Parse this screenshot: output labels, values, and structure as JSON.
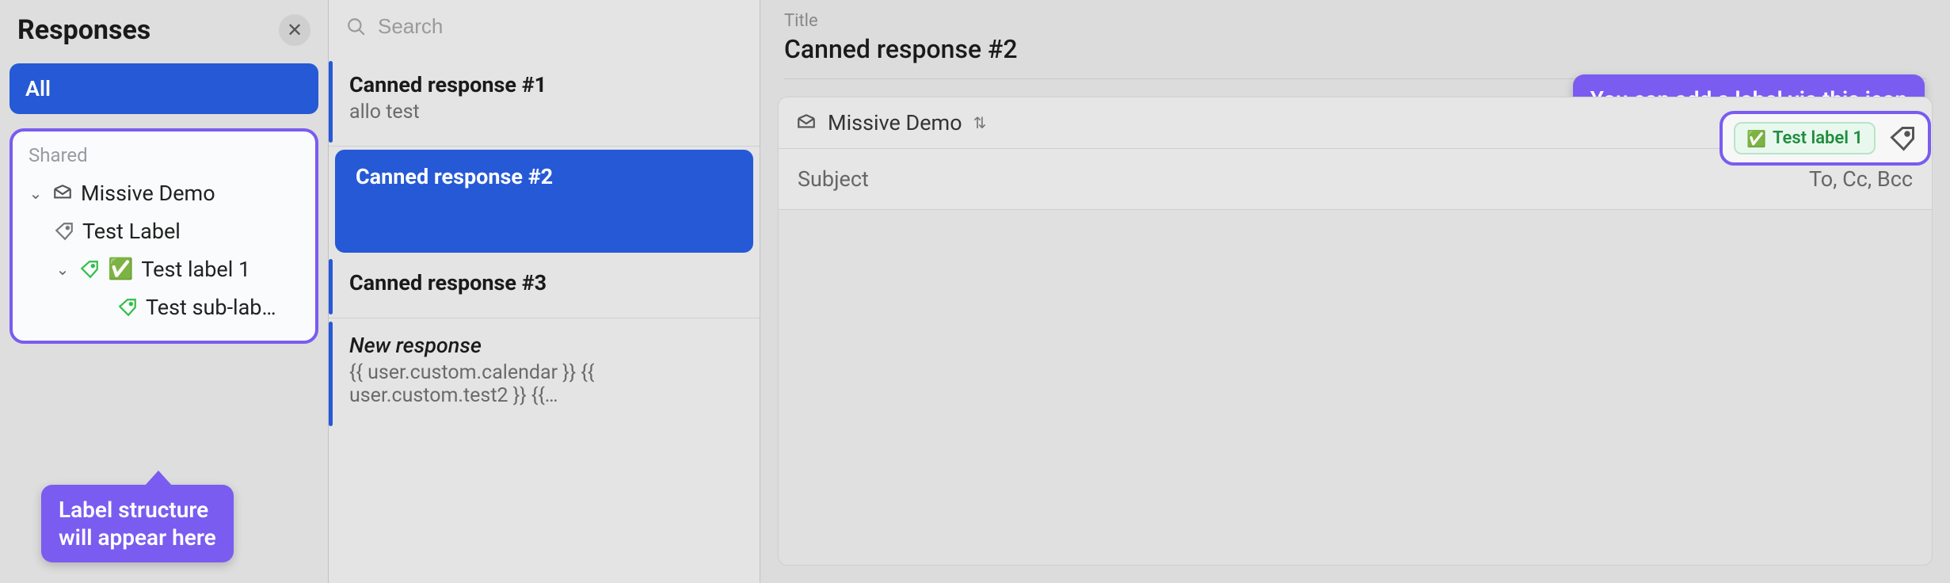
{
  "sidebar": {
    "title": "Responses",
    "all_label": "All",
    "shared_heading": "Shared",
    "tree": {
      "org": "Missive Demo",
      "label1": "Test Label",
      "label2": "Test label 1",
      "label3": "Test sub-lab…"
    }
  },
  "callouts": {
    "label_structure": "Label structure\nwill appear here",
    "add_label": "You can add a label via this icon"
  },
  "search": {
    "placeholder": "Search"
  },
  "responses": [
    {
      "title": "Canned response #1",
      "sub": "allo test",
      "selected": false
    },
    {
      "title": "Canned response #2",
      "sub": "",
      "selected": true
    },
    {
      "title": "Canned response #3",
      "sub": "",
      "selected": false
    },
    {
      "title": "New response",
      "sub": "{{ user.custom.calendar }} {{ user.custom.test2 }} {{…",
      "italic": true,
      "selected": false
    }
  ],
  "detail": {
    "title_label": "Title",
    "title_value": "Canned response #2",
    "org": "Missive Demo",
    "chip": "Test label 1",
    "subject_placeholder": "Subject",
    "recipients_placeholder": "To, Cc, Bcc"
  }
}
